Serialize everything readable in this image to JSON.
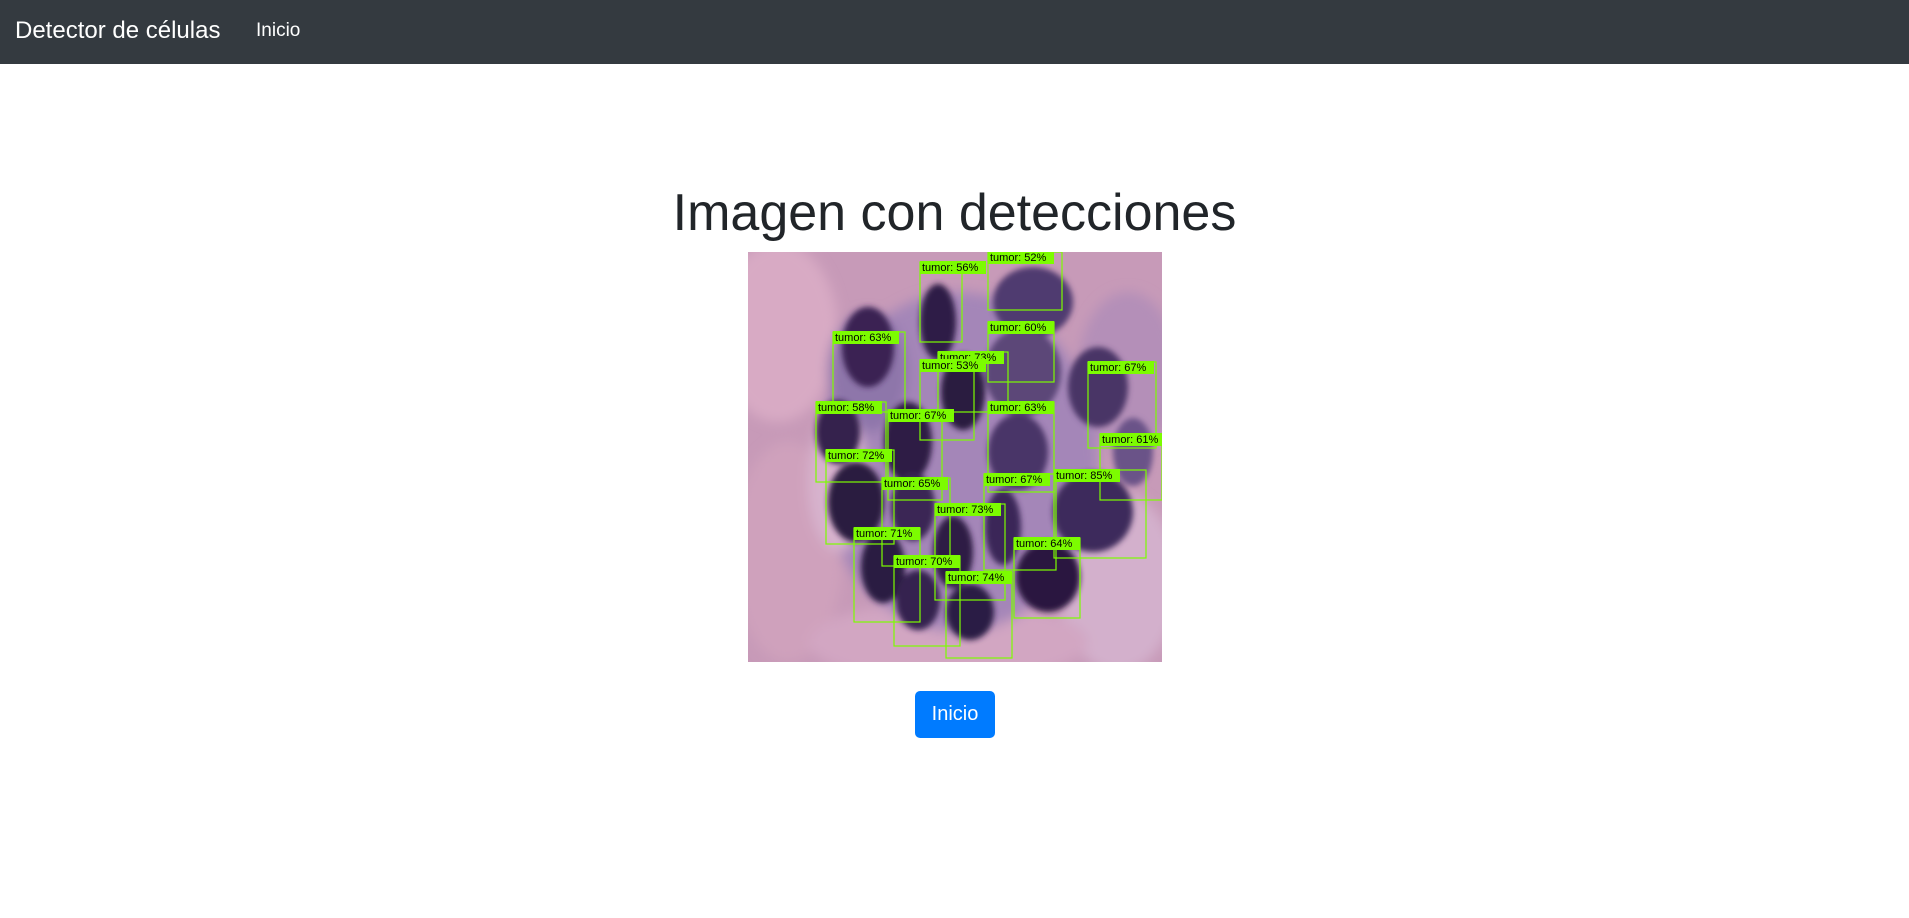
{
  "navbar": {
    "brand": "Detector de células",
    "links": [
      "Inicio"
    ]
  },
  "main": {
    "title": "Imagen con detecciones",
    "image": {
      "subject": "histology-tissue",
      "detections": [
        {
          "label": "tumor: 56%"
        },
        {
          "label": "tumor: 52%"
        },
        {
          "label": "tumor: 60%"
        },
        {
          "label": "tumor: 63%"
        },
        {
          "label": "tumor: 73%"
        },
        {
          "label": "tumor: 53%"
        },
        {
          "label": "tumor: 67%"
        },
        {
          "label": "tumor: 58%"
        },
        {
          "label": "tumor: 67%"
        },
        {
          "label": "tumor: 63%"
        },
        {
          "label": "tumor: 61%"
        },
        {
          "label": "tumor: 72%"
        },
        {
          "label": "tumor: 65%"
        },
        {
          "label": "tumor: 67%"
        },
        {
          "label": "tumor: 85%"
        },
        {
          "label": "tumor: 73%"
        },
        {
          "label": "tumor: 71%"
        },
        {
          "label": "tumor: 64%"
        },
        {
          "label": "tumor: 70%"
        },
        {
          "label": "tumor: 74%"
        }
      ],
      "box_color": "#7cfc00"
    },
    "button_label": "Inicio"
  },
  "colors": {
    "navbar_bg": "#343a40",
    "primary": "#007bff"
  }
}
